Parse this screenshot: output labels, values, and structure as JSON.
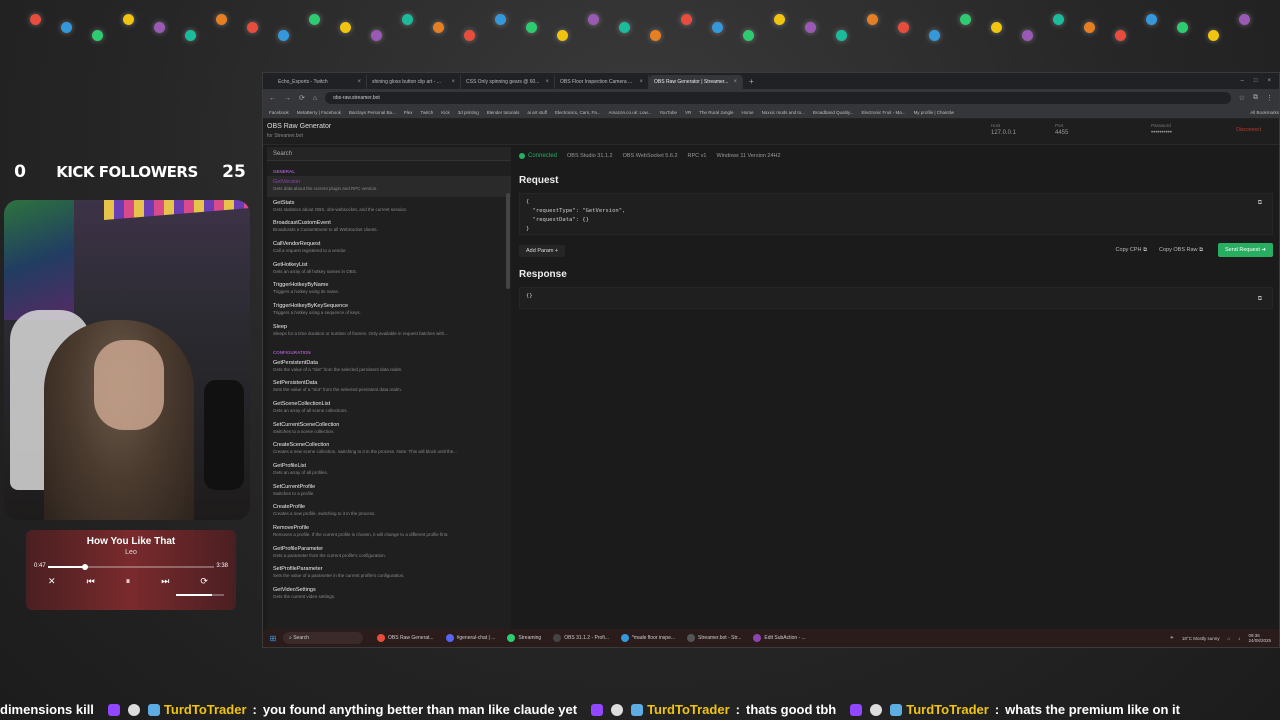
{
  "followers": {
    "left_count": "0",
    "label": "KICK FOLLOWERS",
    "right_count": "25"
  },
  "music": {
    "title": "How You Like That",
    "artist": "Leo",
    "elapsed": "0:47",
    "duration": "3:38",
    "progress_fraction": 0.22,
    "volume_fraction": 0.75
  },
  "browser": {
    "tabs": [
      {
        "label": "Echo_Esports - Twitch",
        "active": false
      },
      {
        "label": "shining gloss button clip art - ...",
        "active": false
      },
      {
        "label": "CSS Only spinning gears @ 60...",
        "active": false
      },
      {
        "label": "OBS Floor Inspection Camera ...",
        "active": false
      },
      {
        "label": "OBS Raw Generator | Streamer...",
        "active": true
      }
    ],
    "url": "obs-raw.streamer.bot",
    "bookmarks": [
      "Facebook",
      "MetaBerry | Facebook",
      "Barclays Personal Ba...",
      "Plex",
      "Twitch",
      "Kick",
      "3d printing",
      "Blender tutorials",
      "ai art stuff",
      "Electronics, Cars, Fa...",
      "Amazon.co.uk: Low...",
      "YouTube",
      "VR",
      "The Rural Jungle",
      "Home",
      "Noxxic mods and to...",
      "Broadband Quality...",
      "Electronic Fruit - Ma...",
      "My profile | Chaintlw",
      "All Bookmarks"
    ]
  },
  "app": {
    "title": "OBS Raw Generator",
    "subtitle": "for Streamer.bot",
    "host_label": "Host",
    "host_value": "127.0.0.1",
    "port_label": "Port",
    "port_value": "4455",
    "password_label": "Password",
    "password_value": "••••••••••",
    "disconnect_label": "Disconnect",
    "search_placeholder": "Search",
    "status": {
      "connected": "Connected",
      "obs": "OBS Studio 31.1.2",
      "ws": "OBS WebSocket 5.6.2",
      "rpc": "RPC v1",
      "os": "Windows 11 Version 24H2"
    },
    "categories": [
      {
        "name": "GENERAL",
        "items": [
          {
            "name": "GetVersion",
            "desc": "Gets data about the current plugin and RPC version.",
            "selected": true
          },
          {
            "name": "GetStats",
            "desc": "Gets statistics about OBS, obs-websocket, and the current session.",
            "selected": false
          },
          {
            "name": "BroadcastCustomEvent",
            "desc": "Broadcasts a CustomEvent to all WebSocket clients.",
            "selected": false
          },
          {
            "name": "CallVendorRequest",
            "desc": "Call a request registered to a vendor.",
            "selected": false
          },
          {
            "name": "GetHotkeyList",
            "desc": "Gets an array of all hotkey names in OBS.",
            "selected": false
          },
          {
            "name": "TriggerHotkeyByName",
            "desc": "Triggers a hotkey using its name.",
            "selected": false
          },
          {
            "name": "TriggerHotkeyByKeySequence",
            "desc": "Triggers a hotkey using a sequence of keys.",
            "selected": false
          },
          {
            "name": "Sleep",
            "desc": "Sleeps for a time duration or number of frames. Only available in request batches with...",
            "selected": false
          }
        ]
      },
      {
        "name": "CONFIGURATION",
        "items": [
          {
            "name": "GetPersistentData",
            "desc": "Gets the value of a \"slot\" from the selected persistent data realm.",
            "selected": false
          },
          {
            "name": "SetPersistentData",
            "desc": "Sets the value of a \"slot\" from the selected persistent data realm.",
            "selected": false
          },
          {
            "name": "GetSceneCollectionList",
            "desc": "Gets an array of all scene collections.",
            "selected": false
          },
          {
            "name": "SetCurrentSceneCollection",
            "desc": "Switches to a scene collection.",
            "selected": false
          },
          {
            "name": "CreateSceneCollection",
            "desc": "Creates a new scene collection, switching to it in the process. Note: This will block until the...",
            "selected": false
          },
          {
            "name": "GetProfileList",
            "desc": "Gets an array of all profiles.",
            "selected": false
          },
          {
            "name": "SetCurrentProfile",
            "desc": "Switches to a profile.",
            "selected": false
          },
          {
            "name": "CreateProfile",
            "desc": "Creates a new profile, switching to it in the process.",
            "selected": false
          },
          {
            "name": "RemoveProfile",
            "desc": "Removes a profile. If the current profile is chosen, it will change to a different profile first.",
            "selected": false
          },
          {
            "name": "GetProfileParameter",
            "desc": "Gets a parameter from the current profile's configuration.",
            "selected": false
          },
          {
            "name": "SetProfileParameter",
            "desc": "Sets the value of a parameter in the current profile's configuration.",
            "selected": false
          },
          {
            "name": "GetVideoSettings",
            "desc": "Gets the current video settings.",
            "selected": false
          }
        ]
      }
    ],
    "request_heading": "Request",
    "request_lines": [
      "{",
      "  \"requestType\": \"GetVersion\",",
      "  \"requestData\": {}",
      "}"
    ],
    "add_param_label": "Add Param  +",
    "copy_cph_label": "Copy CPH",
    "copy_obs_label": "Copy OBS Raw",
    "send_label": "Send Request",
    "response_heading": "Response",
    "response_text": "{}"
  },
  "taskbar": {
    "search": "Search",
    "apps": [
      "OBS Raw Generat...",
      "#general-chat | ...",
      "Streaming",
      "OBS 31.1.2 - Profi...",
      "*made floor inspe...",
      "Streamer.bot - Str...",
      "Edit SubAction - ..."
    ],
    "weather": "18°C",
    "weather_desc": "Mostly sunny",
    "time": "09:36",
    "date": "24/08/2025"
  },
  "ticker": [
    {
      "user": "",
      "text": "dimensions kill"
    },
    {
      "user": "TurdToTrader",
      "text": "you found anything better than man like claude yet"
    },
    {
      "user": "TurdToTrader",
      "text": "thats good tbh"
    },
    {
      "user": "TurdToTrader",
      "text": "whats the premium like on it"
    }
  ],
  "colors": {
    "accent_purple": "#8e44ad",
    "connected_green": "#27ae60",
    "send_green": "#27ae60",
    "username_yellow": "#f1c40f"
  }
}
